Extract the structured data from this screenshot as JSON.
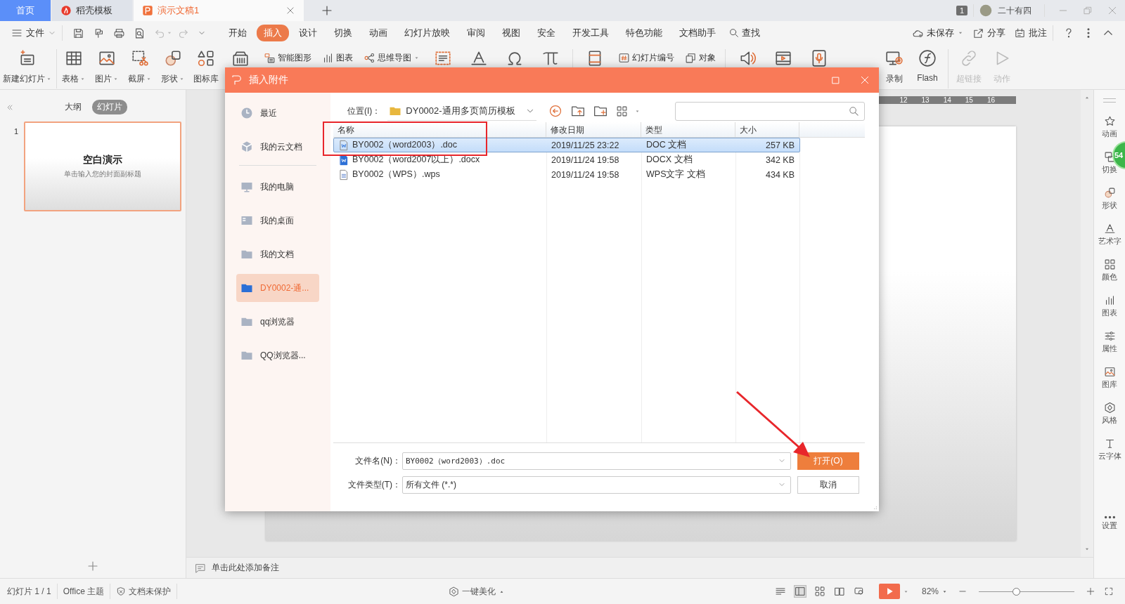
{
  "tabs": [
    {
      "kind": "home",
      "label": "首页",
      "selected": false
    },
    {
      "kind": "template",
      "label": "稻壳模板",
      "selected": false
    },
    {
      "kind": "doc",
      "label": "演示文稿1",
      "selected": true
    }
  ],
  "account": {
    "window_count": "1",
    "user": "二十有四"
  },
  "file_menu": "文件",
  "quick_access": [
    {
      "disabled": false
    },
    {
      "disabled": false
    },
    {
      "disabled": false
    },
    {
      "disabled": false
    },
    {
      "disabled": true
    },
    {
      "disabled": true
    },
    {
      "disabled": false
    }
  ],
  "menu_tabs": [
    {
      "label": "开始",
      "selected": false
    },
    {
      "label": "插入",
      "selected": true
    },
    {
      "label": "设计",
      "selected": false
    },
    {
      "label": "切换",
      "selected": false
    },
    {
      "label": "动画",
      "selected": false
    },
    {
      "label": "幻灯片放映",
      "selected": false
    },
    {
      "label": "审阅",
      "selected": false
    },
    {
      "label": "视图",
      "selected": false
    },
    {
      "label": "安全",
      "selected": false
    },
    {
      "label": "开发工具",
      "selected": false
    },
    {
      "label": "特色功能",
      "selected": false
    },
    {
      "label": "文档助手",
      "selected": false
    }
  ],
  "find": "查找",
  "actions": [
    {
      "label": "未保存",
      "dropdown": true
    },
    {
      "label": "分享",
      "dropdown": false
    },
    {
      "label": "批注",
      "dropdown": false
    }
  ],
  "ribbon": [
    [
      {
        "kind": "large",
        "label": "新建幻灯片",
        "dropdown": true,
        "disabled": false
      }
    ],
    [
      {
        "kind": "large",
        "label": "表格",
        "dropdown": true,
        "disabled": false
      },
      {
        "kind": "large",
        "label": "图片",
        "dropdown": true,
        "disabled": false
      },
      {
        "kind": "large",
        "label": "截屏",
        "dropdown": true,
        "disabled": false
      },
      {
        "kind": "large",
        "label": "形状",
        "dropdown": true,
        "disabled": false
      },
      {
        "kind": "large",
        "label": "图标库",
        "dropdown": false,
        "disabled": false
      },
      {
        "kind": "icon",
        "disabled": false
      },
      {
        "kind": "small",
        "label": "智能图形",
        "dropdown": false,
        "disabled": false
      },
      {
        "kind": "small",
        "label": "图表",
        "dropdown": false,
        "disabled": false
      },
      {
        "kind": "small",
        "label": "思维导图",
        "dropdown": true,
        "disabled": false
      },
      {
        "kind": "icon",
        "disabled": false
      },
      {
        "kind": "icon",
        "disabled": false
      },
      {
        "kind": "icon",
        "disabled": false
      },
      {
        "kind": "icon",
        "disabled": false
      }
    ],
    [
      {
        "kind": "icon",
        "disabled": false
      },
      {
        "kind": "small",
        "label": "幻灯片编号",
        "dropdown": false,
        "disabled": false
      },
      {
        "kind": "small",
        "label": "对象",
        "dropdown": false,
        "disabled": false
      }
    ],
    [
      {
        "kind": "icon",
        "disabled": false
      },
      {
        "kind": "icon",
        "disabled": false
      },
      {
        "kind": "icon",
        "disabled": false
      },
      {
        "kind": "large",
        "label": "录制",
        "dropdown": false,
        "disabled": false
      },
      {
        "kind": "large",
        "label": "Flash",
        "dropdown": false,
        "disabled": false
      }
    ],
    [
      {
        "kind": "large",
        "label": "超链接",
        "dropdown": false,
        "disabled": true
      },
      {
        "kind": "large",
        "label": "动作",
        "dropdown": false,
        "disabled": true
      }
    ]
  ],
  "view_toggle": [
    {
      "label": "大纲",
      "selected": false
    },
    {
      "label": "幻灯片",
      "selected": true
    }
  ],
  "slides": [
    {
      "number": "1",
      "title": "空白演示",
      "subtitle": "单击输入您的封面副标题",
      "selected": true
    }
  ],
  "ruler": [
    "12",
    "13",
    "14",
    "15",
    "16"
  ],
  "notes_placeholder": "单击此处添加备注",
  "right_panel": [
    "动画",
    "切换",
    "形状",
    "艺术字",
    "颜色",
    "图表",
    "属性",
    "图库",
    "风格",
    "云字体",
    "设置"
  ],
  "right_badge": "54",
  "status": {
    "slide": "幻灯片 1 / 1",
    "theme": "Office 主题",
    "protect": "文档未保护",
    "beautify": "一键美化",
    "zoom": "82%",
    "zoom_slider": {
      "level": 0.39
    }
  },
  "dialog": {
    "title": "插入附件",
    "places": [
      [
        {
          "label": "最近",
          "selected": false
        },
        {
          "label": "我的云文档",
          "selected": false
        }
      ],
      [
        {
          "label": "我的电脑",
          "selected": false
        },
        {
          "label": "我的桌面",
          "selected": false
        },
        {
          "label": "我的文档",
          "selected": false
        },
        {
          "label": "DY0002-通...",
          "selected": true
        },
        {
          "label": "qq浏览器",
          "selected": false
        },
        {
          "label": "QQ浏览器...",
          "selected": false
        }
      ]
    ],
    "location_label": "位置(I)：",
    "location": "DY0002-通用多页简历模板",
    "columns": [
      "名称",
      "修改日期",
      "类型",
      "大小"
    ],
    "files": [
      {
        "kind": "doc",
        "selected": true,
        "cells": [
          "BY0002（word2003）.doc",
          "2019/11/25 23:22",
          "DOC 文档",
          "257 KB"
        ]
      },
      {
        "kind": "docx",
        "selected": false,
        "cells": [
          "BY0002（word2007以上）.docx",
          "2019/11/24 19:58",
          "DOCX 文档",
          "342 KB"
        ]
      },
      {
        "kind": "wps",
        "selected": false,
        "cells": [
          "BY0002（WPS）.wps",
          "2019/11/24 19:58",
          "WPS文字 文档",
          "434 KB"
        ]
      }
    ],
    "filename_label": "文件名(N)：",
    "filename": "BY0002（word2003）.doc",
    "filetype_label": "文件类型(T)：",
    "filetype": "所有文件 (*.*)",
    "open": "打开(O)",
    "cancel": "取消"
  }
}
